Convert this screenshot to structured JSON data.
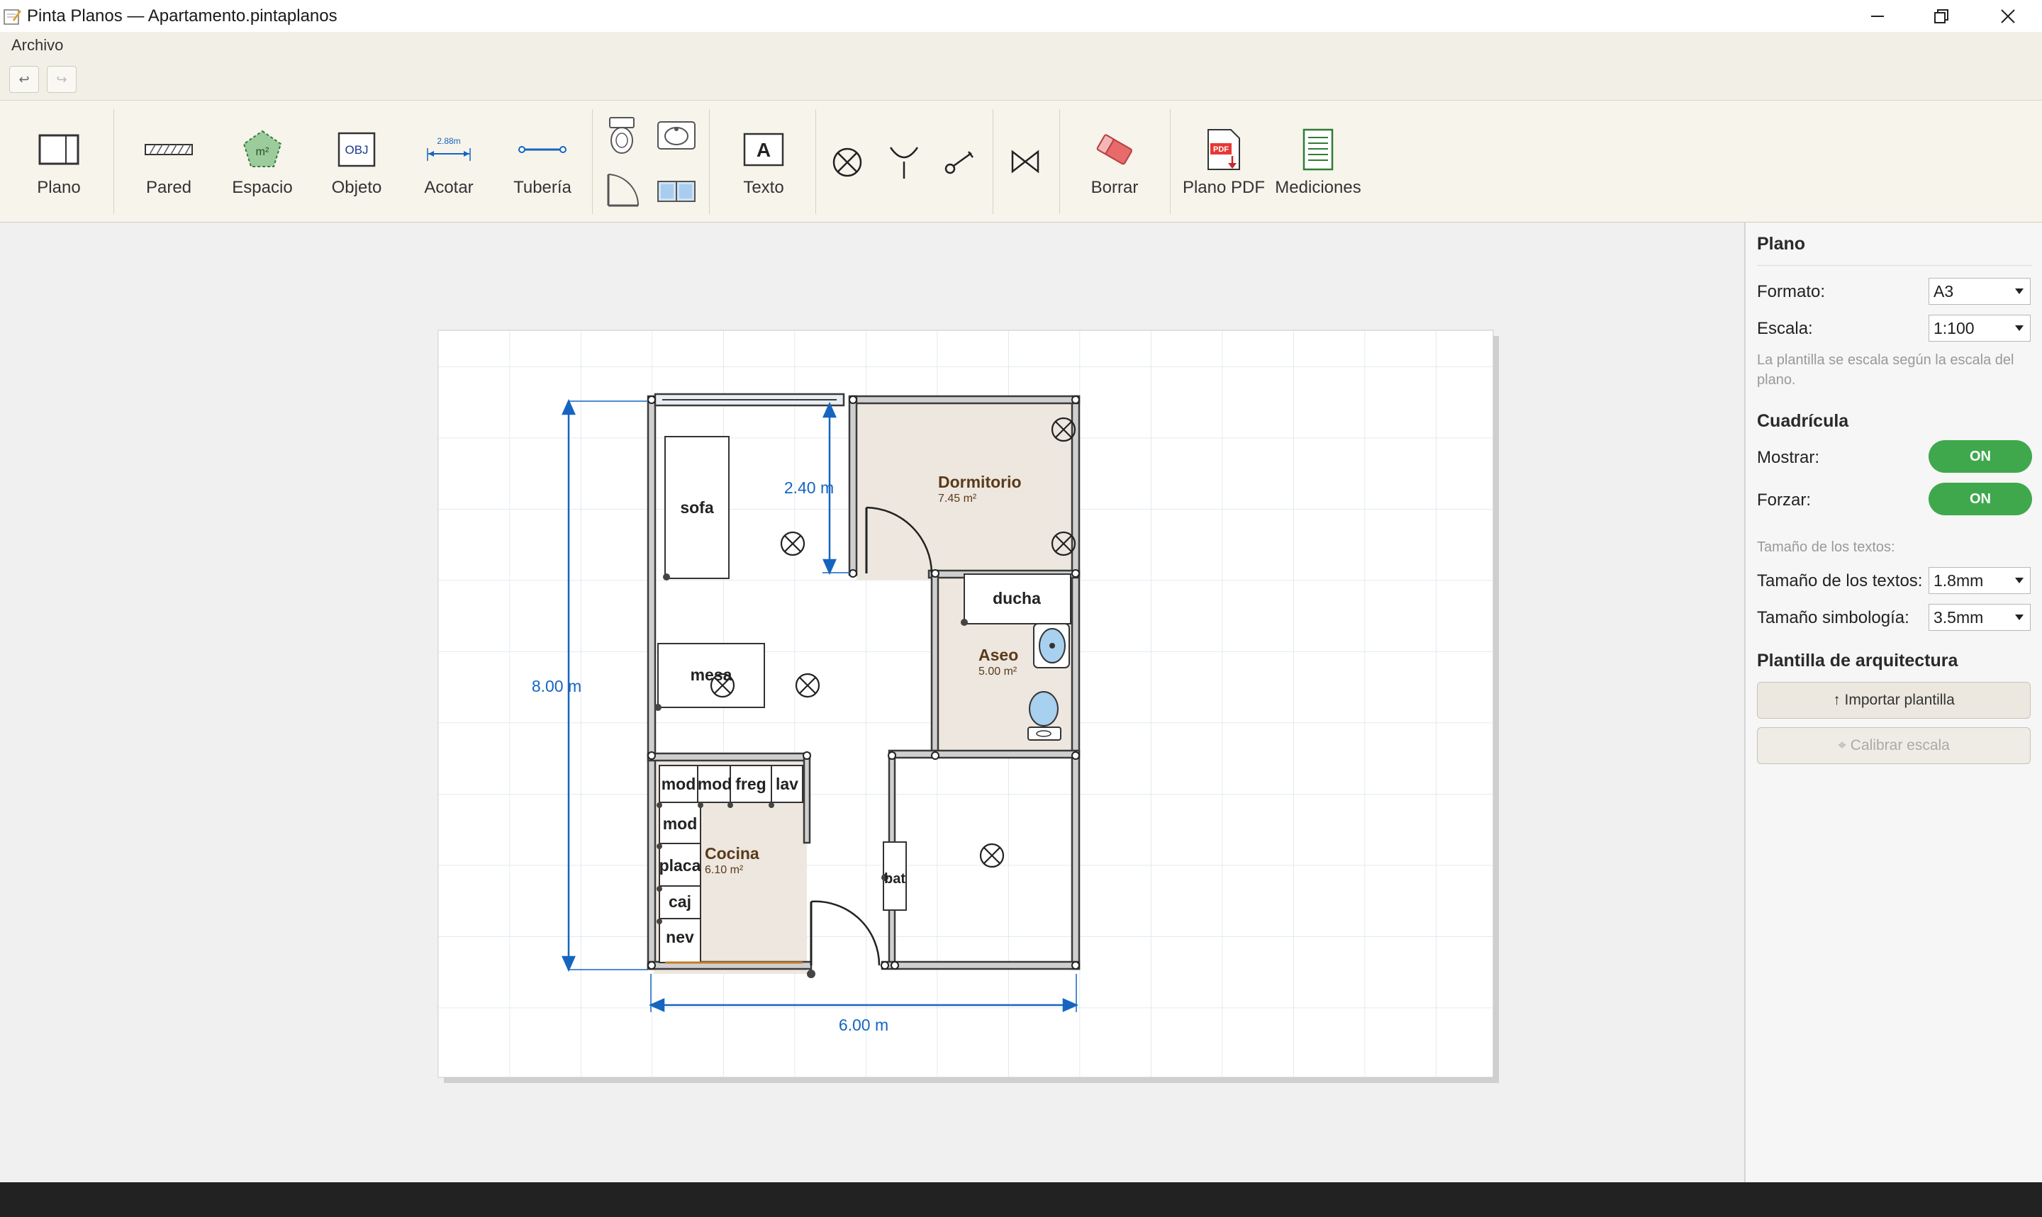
{
  "window": {
    "title": "Pinta Planos — Apartamento.pintaplanos",
    "controls": [
      "minimize",
      "restore",
      "close"
    ]
  },
  "menu": {
    "archivo": "Archivo"
  },
  "history": {
    "undo_icon": "undo-icon",
    "redo_icon": "redo-icon"
  },
  "toolbar": {
    "plano": "Plano",
    "pared": "Pared",
    "espacio": "Espacio",
    "espacio_icon_text": "m²",
    "objeto": "Objeto",
    "objeto_icon_text": "OBJ",
    "acotar": "Acotar",
    "acotar_icon_text": "2.88m",
    "tuberia": "Tubería",
    "texto": "Texto",
    "texto_icon_text": "A",
    "borrar": "Borrar",
    "plano_pdf": "Plano PDF",
    "pdf_icon_text": "PDF",
    "mediciones": "Mediciones"
  },
  "plan": {
    "rooms": {
      "dormitorio": {
        "name": "Dormitorio",
        "area": "7.45 m²"
      },
      "aseo": {
        "name": "Aseo",
        "area": "5.00 m²"
      },
      "cocina": {
        "name": "Cocina",
        "area": "6.10 m²"
      }
    },
    "objects": {
      "sofa": "sofa",
      "mesa": "mesa",
      "ducha": "ducha",
      "mod1": "mod",
      "mod2": "mod",
      "freg": "freg",
      "lav": "lav",
      "mod3": "mod",
      "placa": "placa",
      "caj": "caj",
      "nev": "nev",
      "bat": "bat"
    },
    "dimensions": {
      "height": "8.00 m",
      "width": "6.00 m",
      "dormitorio_depth": "2.40 m"
    }
  },
  "panel": {
    "title": "Plano",
    "formato_label": "Formato:",
    "formato_value": "A3",
    "escala_label": "Escala:",
    "escala_value": "1:100",
    "escala_hint_1": "La plantilla se escala según la escala del",
    "escala_hint_2": "plano.",
    "grid_title": "Cuadrícula",
    "mostrar_label": "Mostrar:",
    "mostrar_value": "ON",
    "forzar_label": "Forzar:",
    "forzar_value": "ON",
    "text_size_hint": "Tamaño de los textos:",
    "text_size_label": "Tamaño de los textos:",
    "text_size_value": "1.8mm",
    "symbol_size_label": "Tamaño simbología:",
    "symbol_size_value": "3.5mm",
    "template_title": "Plantilla de arquitectura",
    "import_button": "↑ Importar plantilla",
    "calibrate_button": "⌖ Calibrar escala"
  },
  "colors": {
    "accent_blue": "#1565c0",
    "toggle_green": "#3fa84d",
    "room_fill": "#ede7df",
    "room_label": "#5a3a1a"
  }
}
